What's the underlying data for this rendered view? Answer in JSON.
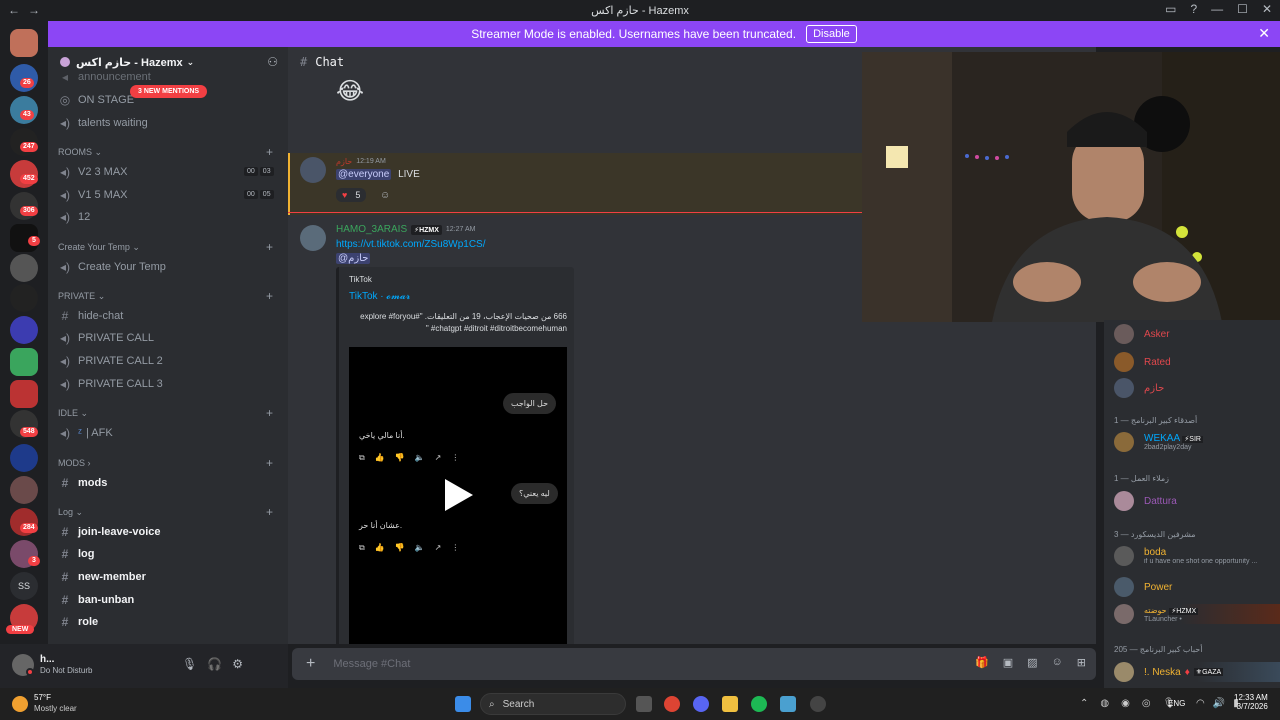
{
  "window": {
    "title": "حازم اكس - Hazemx"
  },
  "streamer_banner": {
    "text": "Streamer Mode is enabled. Usernames have been truncated.",
    "button": "Disable"
  },
  "guild_badges": [
    "26",
    "43",
    "247",
    "452",
    "306",
    "5",
    "548",
    "284",
    "3"
  ],
  "guild_labels": [
    "SS",
    "NEW"
  ],
  "server": {
    "name": "حازم اكس - Hazemx",
    "new_mentions": "3 NEW MENTIONS"
  },
  "channels": {
    "announcement": "announcement",
    "on_stage": "ON STAGE",
    "talents": "talents waiting",
    "rooms_cat": "ROOMS",
    "v2": "V2 3 MAX",
    "v2_count": [
      "00",
      "03"
    ],
    "v1": "V1 5 MAX",
    "v1_count": [
      "00",
      "05"
    ],
    "twelve": "12",
    "create_cat": "Create Your Temp",
    "create": "Create Your Temp",
    "private_cat": "PRIVATE",
    "hide_chat": "hide-chat",
    "pc1": "PRIVATE CALL",
    "pc2": "PRIVATE CALL 2",
    "pc3": "PRIVATE CALL 3",
    "idle_cat": "IDLE",
    "afk": "| AFK",
    "mods_cat": "MODS",
    "mods": "mods",
    "log_cat": "Log",
    "jlv": "join-leave-voice",
    "log": "log",
    "new_member": "new-member",
    "ban_unban": "ban-unban",
    "role": "role"
  },
  "user": {
    "name": "h...",
    "status": "Do Not Disturb"
  },
  "chat": {
    "channel": "Chat",
    "placeholder": "Message #Chat"
  },
  "messages": {
    "m1_name": "حازم",
    "m1_time": "12:19 AM",
    "m1_mention": "@everyone",
    "m1_text": "LIVE",
    "m1_reaction_count": "5",
    "m2_name": "HAMO_3ARAIS",
    "m2_tag": "HZMX",
    "m2_time": "12:27 AM",
    "m2_link": "https://vt.tiktok.com/ZSu8Wp1CS/",
    "m2_mention": "@حازم",
    "embed_provider": "TikTok",
    "embed_title": "TikTok · 𝓸𝓶𝓪𝓻",
    "embed_desc": "666 من صحيات الإعجاب، 19 من التعليقات. \"explore #foryou# #chatgpt #ditroit #ditroitbecomehuman \"",
    "video_pill1": "حل الواجب",
    "video_text1": "أنا مالي ياخي.",
    "video_pill2": "ليه يعني؟",
    "video_text2": "عشان أنا حر."
  },
  "members": {
    "m_asker": "Asker",
    "m_rated": "Rated",
    "m_hazem": "حازم",
    "g1": "أصدقاء كبير البرنامج — 1",
    "m_wekaa": "WEKAA",
    "m_wekaa_tag": "SIR",
    "m_wekaa_sub": "2bad2play2day",
    "g2": "زملاء العمل — 1",
    "m_dattura": "Dattura",
    "g3": "مشرفين الديسكورد — 3",
    "m_boda": "boda",
    "m_boda_sub": "if u have one shot one opportunity ...",
    "m_power": "Power",
    "m_howa": "حوضته",
    "m_howa_tag": "HZMX",
    "m_howa_sub": "TLauncher •",
    "g4": "أحباب كبير البرنامج — 205",
    "m_neska": "!. Neska",
    "m_neska_tag": "GAZA"
  },
  "taskbar": {
    "weather_temp": "57°F",
    "weather_desc": "Mostly clear",
    "search": "Search",
    "lang": "ENG",
    "time": "12:33 AM",
    "date": "3/7/2026"
  }
}
